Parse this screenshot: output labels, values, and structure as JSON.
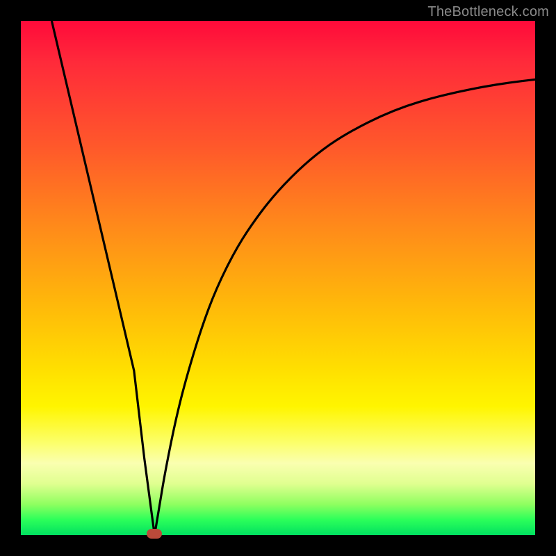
{
  "watermark": "TheBottleneck.com",
  "accent_colors": {
    "curve": "#000000",
    "marker": "#bb4a3a",
    "background_top": "#ff0a3a",
    "background_bottom": "#00e060"
  },
  "chart_data": {
    "type": "line",
    "title": "",
    "xlabel": "",
    "ylabel": "",
    "xlim": [
      0,
      100
    ],
    "ylim": [
      0,
      100
    ],
    "left_branch": {
      "x": [
        6,
        10,
        14,
        18,
        22,
        24,
        26
      ],
      "y": [
        100,
        83,
        66,
        49,
        32,
        15,
        0
      ]
    },
    "right_branch": {
      "x": [
        26,
        27,
        28,
        30,
        32,
        35,
        38,
        42,
        46,
        50,
        55,
        60,
        65,
        70,
        75,
        80,
        85,
        90,
        95,
        100
      ],
      "y": [
        0,
        6,
        12,
        22,
        30,
        40,
        48,
        56,
        62,
        67,
        72,
        76,
        79,
        81.5,
        83.5,
        85,
        86.2,
        87.2,
        88,
        88.6
      ]
    },
    "marker": {
      "x": 26,
      "y": 0
    }
  }
}
